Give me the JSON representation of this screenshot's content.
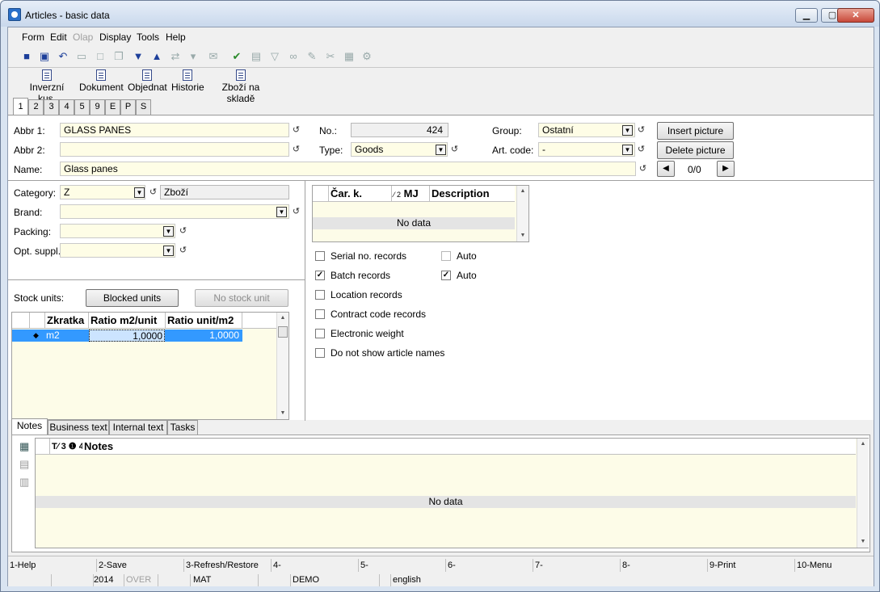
{
  "window": {
    "title": "Articles - basic data",
    "minimize": "▁",
    "maximize": "▢",
    "close": "✕"
  },
  "menu": [
    "Form",
    "Edit",
    "Olap",
    "Display",
    "Tools",
    "Help"
  ],
  "big_toolbar": [
    "Inverzní kus.",
    "Dokument",
    "Objednat",
    "Historie",
    "Zboží na skladě"
  ],
  "top_tabs": [
    "1",
    "2",
    "3",
    "4",
    "5",
    "9",
    "E",
    "P",
    "S"
  ],
  "form": {
    "abbr1_label": "Abbr 1:",
    "abbr1_value": "GLASS PANES",
    "abbr2_label": "Abbr 2:",
    "abbr2_value": "",
    "name_label": "Name:",
    "name_value": "Glass panes",
    "no_label": "No.:",
    "no_value": "424",
    "type_label": "Type:",
    "type_value": "Goods",
    "group_label": "Group:",
    "group_value": "Ostatní",
    "artcode_label": "Art. code:",
    "artcode_value": "-",
    "insert_picture": "Insert picture",
    "delete_picture": "Delete picture",
    "picture_counter": "0/0",
    "prev_arrow": "◀",
    "next_arrow": "▶",
    "category_label": "Category:",
    "category_value": "Z",
    "category_desc": "Zboží",
    "brand_label": "Brand:",
    "brand_value": "",
    "packing_label": "Packing:",
    "packing_value": "",
    "optsuppl_label": "Opt. suppl.:",
    "optsuppl_value": "",
    "stock_units_label": "Stock units:",
    "blocked_units": "Blocked units",
    "no_stock_unit": "No stock unit"
  },
  "units_grid": {
    "columns": [
      "",
      "Zkratka",
      "Ratio m2/unit",
      "Ratio unit/m2"
    ],
    "rows": [
      {
        "marker": "◆",
        "zkratka": "m2",
        "ratio1": "1,0000",
        "ratio2": "1,0000"
      }
    ]
  },
  "barcode_grid": {
    "col1": "Čar. k.",
    "col2_sort": "⁄ 2",
    "col2": "MJ",
    "col3": "Description",
    "empty": "No data"
  },
  "checks": [
    {
      "label": "Serial no. records",
      "checked": false,
      "auto_label": "Auto",
      "auto_checked": false
    },
    {
      "label": "Batch records",
      "checked": true,
      "auto_label": "Auto",
      "auto_checked": true
    },
    {
      "label": "Location records",
      "checked": false
    },
    {
      "label": "Contract code records",
      "checked": false
    },
    {
      "label": "Electronic weight",
      "checked": false
    },
    {
      "label": "Do not show article names",
      "checked": false
    }
  ],
  "bottom_tabs": [
    "Notes",
    "Business text",
    "Internal text",
    "Tasks"
  ],
  "notes_grid": {
    "header_icons": "T⁄ 3 ❶ 4",
    "column": "Notes",
    "empty": "No data"
  },
  "function_keys": [
    "1-Help",
    "2-Save",
    "3-Refresh/Restore",
    "4-",
    "5-",
    "6-",
    "7-",
    "8-",
    "9-Print",
    "10-Menu"
  ],
  "status": {
    "year": "2014",
    "over": "OVER",
    "user": "MAT",
    "db": "DEMO",
    "language": "english"
  },
  "icons": {
    "history": "↺",
    "dropdown": "▼",
    "check": "✓"
  }
}
